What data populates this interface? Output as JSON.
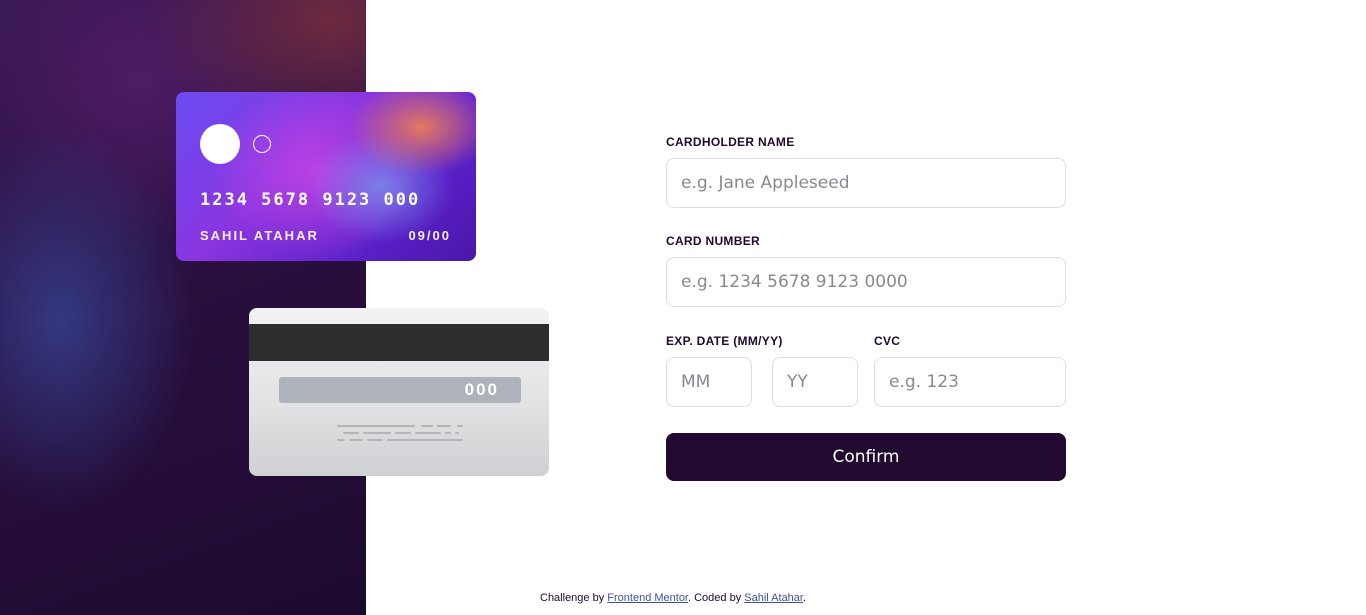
{
  "card_front": {
    "number": "1234 5678 9123 000",
    "name": "SAHIL ATAHAR",
    "expiry": "09/00"
  },
  "card_back": {
    "cvc": "000"
  },
  "form": {
    "cardholder": {
      "label": "CARDHOLDER NAME",
      "placeholder": "e.g. Jane Appleseed"
    },
    "card_number": {
      "label": "CARD NUMBER",
      "placeholder": "e.g. 1234 5678 9123 0000"
    },
    "exp_date": {
      "label": "EXP. DATE (MM/YY)",
      "mm_placeholder": "MM",
      "yy_placeholder": "YY"
    },
    "cvc": {
      "label": "CVC",
      "placeholder": "e.g. 123"
    },
    "confirm_label": "Confirm"
  },
  "footer": {
    "prefix": "Challenge by",
    "link1": "Frontend Mentor",
    "middle": ". Coded by",
    "link2": "Sahil Atahar",
    "suffix": "."
  }
}
